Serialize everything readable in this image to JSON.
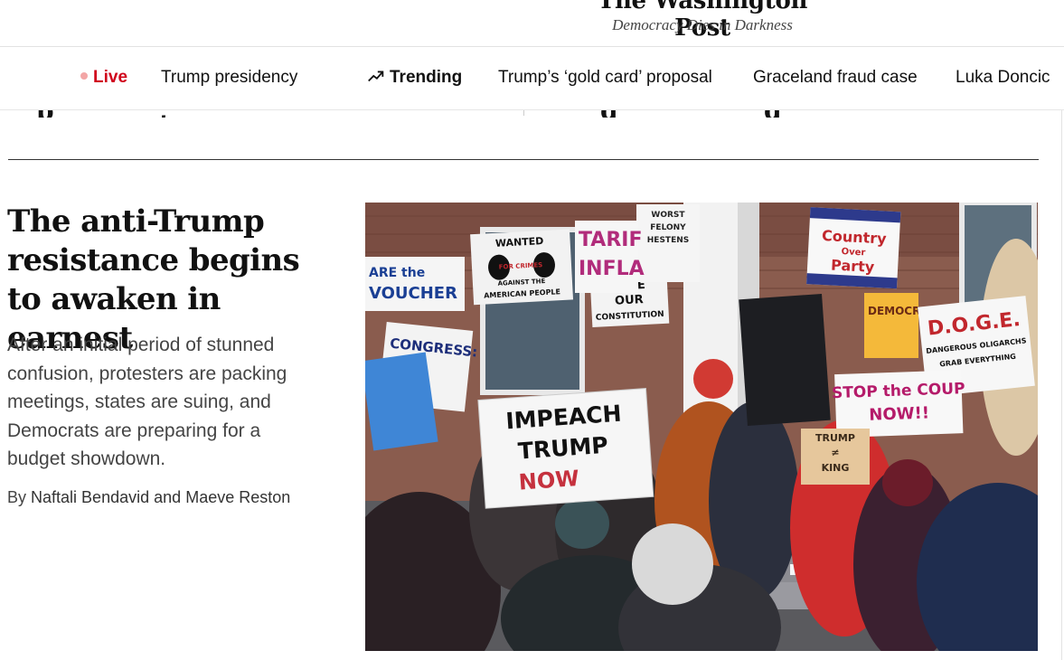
{
  "masthead": {
    "logo": "The Washington Post",
    "tagline": "Democracy Dies in Darkness"
  },
  "nav": {
    "live": "Live",
    "items": [
      "Trump presidency"
    ],
    "trending_label": "Trending",
    "trending_items": [
      "Trump’s ‘gold card’ proposal",
      "Graceland fraud case",
      "Luka Doncic"
    ]
  },
  "story": {
    "headline": "The anti-Trump resistance begins to awaken in earnest",
    "dek": "After an initial period of stunned confusion, protesters are packing meetings, states are suing, and Democrats are preparing for a budget showdown.",
    "byline_prefix": "By",
    "authors": [
      "Naftali Bendavid",
      "Maeve Reston"
    ],
    "byline_joiner": "and"
  },
  "photo": {
    "signs": {
      "impeach": [
        "IMPEACH",
        "TRUMP",
        "NOW"
      ],
      "country": [
        "Country",
        "Over",
        "Party"
      ],
      "save": [
        "SAVE",
        "OUR",
        "CONSTITUTION"
      ],
      "stop": [
        "STOP the COUP",
        "NOW!!"
      ],
      "doge": [
        "D.O.G.E.",
        "DANGEROUS OLIGARCHS",
        "GRAB EVERYTHING"
      ],
      "congress": [
        "CONGRESS:"
      ],
      "tariff": [
        "TARIF",
        "INFLA"
      ],
      "wanted": [
        "WANTED",
        "FOR CRIMES",
        "AGAINST THE",
        "AMERICAN PEOPLE"
      ],
      "voucher": [
        "ARE the",
        "VOUCHER"
      ],
      "worst": [
        "WORST",
        "FELONY",
        "HESTENS"
      ],
      "trump_king": [
        "TRUMP",
        "≠",
        "KING"
      ],
      "democracy": [
        "DEMOCRAC"
      ]
    }
  },
  "colors": {
    "live_red": "#d0021b",
    "text": "#111111",
    "dek": "#444444"
  }
}
